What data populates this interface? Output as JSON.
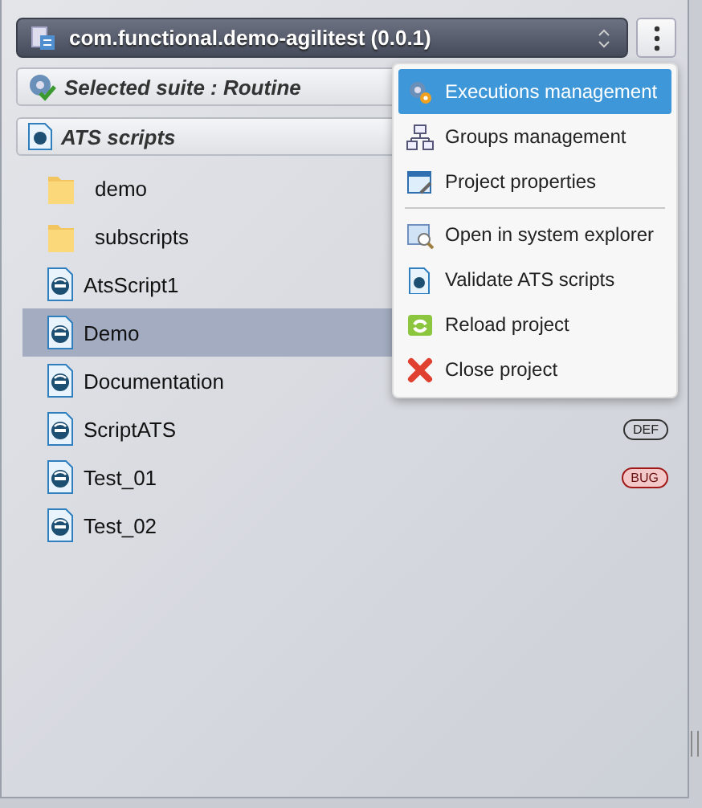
{
  "project": {
    "title": "com.functional.demo-agilitest (0.0.1)"
  },
  "suite": {
    "label": "Selected suite : Routine"
  },
  "scripts_header": {
    "label": "ATS scripts"
  },
  "tree": [
    {
      "kind": "folder",
      "label": "demo",
      "selected": false
    },
    {
      "kind": "folder",
      "label": "subscripts",
      "selected": false
    },
    {
      "kind": "script",
      "label": "AtsScript1",
      "selected": false
    },
    {
      "kind": "script",
      "label": "Demo",
      "selected": true
    },
    {
      "kind": "script",
      "label": "Documentation",
      "selected": false
    },
    {
      "kind": "script",
      "label": "ScriptATS",
      "selected": false,
      "tag": {
        "kind": "def",
        "label": "DEF"
      }
    },
    {
      "kind": "script",
      "label": "Test_01",
      "selected": false,
      "tag": {
        "kind": "bug",
        "label": "BUG"
      }
    },
    {
      "kind": "script",
      "label": "Test_02",
      "selected": false
    }
  ],
  "menu": {
    "groups": [
      [
        {
          "kind": "executions",
          "label": "Executions management",
          "selected": true
        },
        {
          "kind": "groups",
          "label": "Groups management",
          "selected": false
        },
        {
          "kind": "properties",
          "label": "Project properties",
          "selected": false
        }
      ],
      [
        {
          "kind": "explorer",
          "label": "Open in system explorer",
          "selected": false
        },
        {
          "kind": "validate",
          "label": "Validate ATS scripts",
          "selected": false
        },
        {
          "kind": "reload",
          "label": "Reload project",
          "selected": false
        },
        {
          "kind": "close",
          "label": "Close project",
          "selected": false
        }
      ]
    ]
  }
}
